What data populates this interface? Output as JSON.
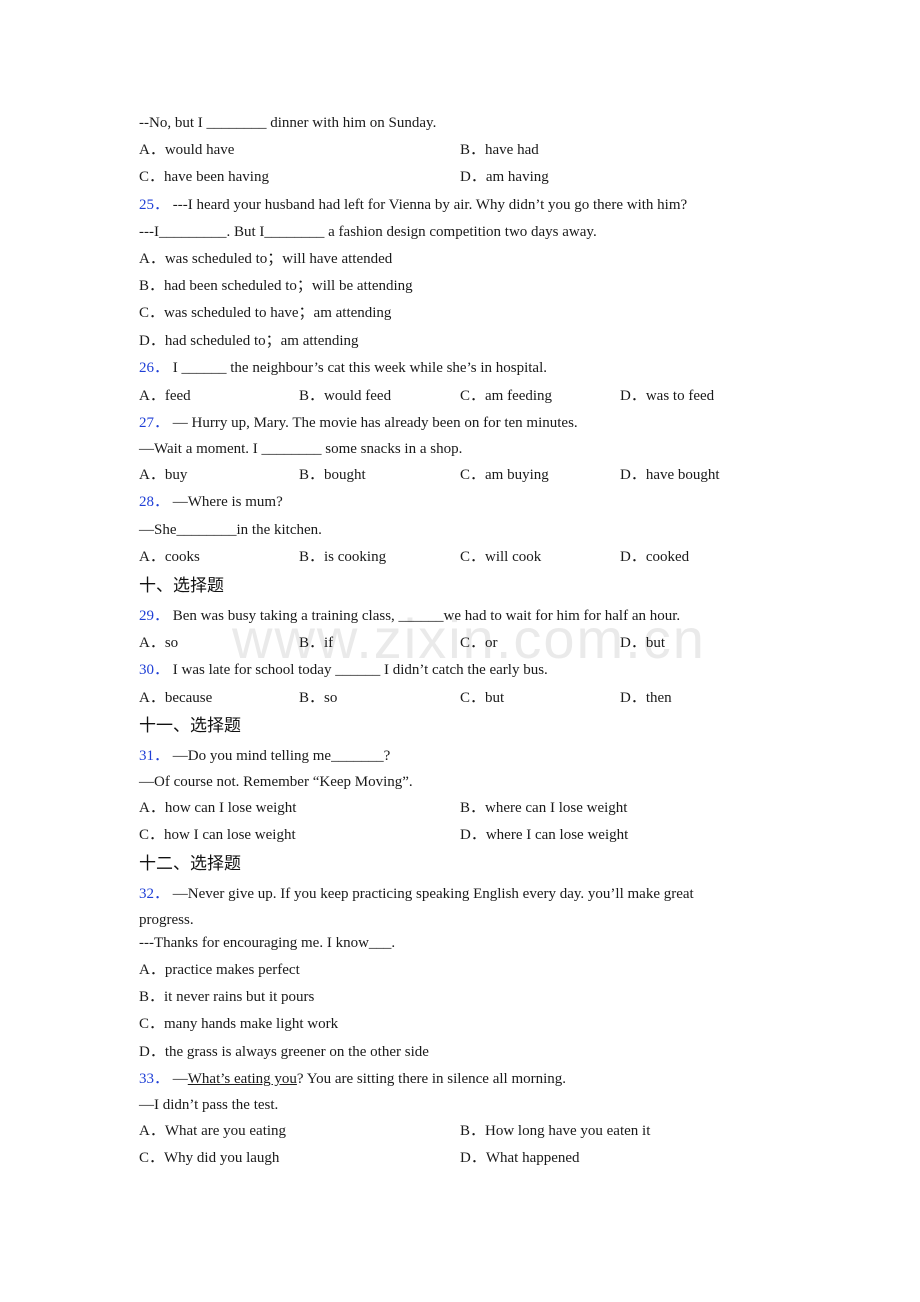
{
  "watermark": "www.zixin.com.cn",
  "q24": {
    "stem_line2": " --No, but I ________ dinner with him on Sunday.",
    "options": [
      "A．would have",
      "B．have had",
      "C．have been having",
      "D．am having"
    ]
  },
  "q25": {
    "number": "25．",
    "stem_line1": " ---I heard your husband had left for Vienna by air.  Why didn’t you go there with him?",
    "stem_line2": "---I_________.  But I________ a fashion design competition two days away.",
    "options": [
      "A．was scheduled to；will have attended",
      "B．had been scheduled to；will be attending",
      "C．was scheduled to have；am attending",
      "D．had scheduled to；am attending"
    ]
  },
  "q26": {
    "number": "26．",
    "stem_line1": " I ______ the neighbour’s cat this week while she’s in hospital.",
    "options": [
      "A．feed",
      "B．would feed",
      "C．am feeding",
      "D．was to feed"
    ]
  },
  "q27": {
    "number": "27．",
    "stem_line1": " — Hurry up, Mary. The movie has already been on for ten minutes.",
    "stem_line2": "—Wait a moment. I ________ some snacks in a shop.",
    "options": [
      "A．buy",
      "B．bought",
      "C．am buying",
      "D．have bought"
    ]
  },
  "q28": {
    "number": "28．",
    "stem_line1": " —Where is mum?",
    "stem_line2": "—She________in the kitchen.",
    "options": [
      "A．cooks",
      "B．is cooking",
      "C．will cook",
      "D．cooked"
    ]
  },
  "section10": {
    "title": "十、选择题"
  },
  "q29": {
    "number": "29．",
    "stem_line1": " Ben was busy taking a training class, ______we had to wait for him for half an hour.",
    "options": [
      "A．so",
      "B．if",
      "C．or",
      "D．but"
    ]
  },
  "q30": {
    "number": "30．",
    "stem_line1": " I was late for school today ______ I didn’t catch the early bus.",
    "options": [
      "A．because",
      "B．so",
      "C．but",
      "D．then"
    ]
  },
  "section11": {
    "title": "十一、选择题"
  },
  "q31": {
    "number": "31．",
    "stem_line1": " —Do you mind telling me_______?",
    "stem_line2": "—Of course not. Remember “Keep Moving”.",
    "options": [
      "A．how can I lose weight",
      "B．where can I lose weight",
      "C．how I can lose weight",
      "D．where I can lose weight"
    ]
  },
  "section12": {
    "title": "十二、选择题"
  },
  "q32": {
    "number": "32．",
    "stem_line1": " —Never give up. If you keep practicing speaking English every day. you’ll make great",
    "stem_line1b": "progress.",
    "stem_line2": "---Thanks for encouraging me. I know___.",
    "options": [
      "A．practice makes perfect",
      "B．it never rains but it pours",
      "C．many hands make light work",
      "D．the grass is always greener on the other side"
    ]
  },
  "q33": {
    "number": "33．",
    "stem_prefix": " —",
    "stem_underlined": "What’s eating you",
    "stem_suffix": "? You are sitting there in silence all morning.",
    "stem_line2": "—I didn’t pass the test.",
    "options": [
      "A．What are you eating",
      "B．How long have you eaten it",
      "C．Why did you laugh",
      "D．What happened"
    ]
  }
}
